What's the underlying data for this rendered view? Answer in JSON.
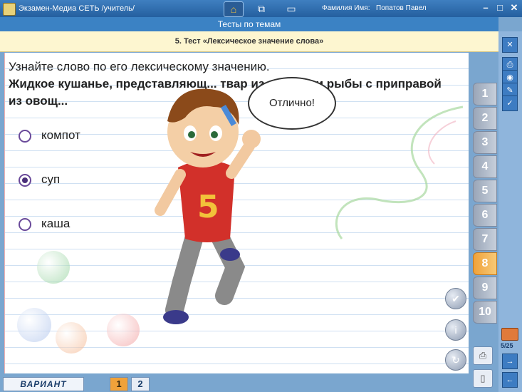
{
  "window": {
    "title": "Экзамен-Медиа СЕТЬ /учитель/",
    "user_label": "Фамилия Имя:",
    "user_name": "Попатов Павел",
    "controls": {
      "minimize": "–",
      "maximize": "□",
      "close": "✕"
    }
  },
  "nav": {
    "home_icon": "home-icon",
    "tree_icon": "sitemap-icon",
    "book_icon": "book-icon"
  },
  "header": {
    "title": "Тесты по темам"
  },
  "test": {
    "title": "5. Тест «Лексическое значение слова»"
  },
  "question": {
    "intro": "Узнайте слово по его лексическому значению.",
    "text": "Жидкое кушанье, представляющ... твар из мяса или рыбы с приправой из овощ..."
  },
  "options": [
    {
      "label": "компот",
      "selected": false
    },
    {
      "label": "суп",
      "selected": true
    },
    {
      "label": "каша",
      "selected": false
    }
  ],
  "feedback": {
    "text": "Отлично!"
  },
  "mascot": {
    "shirt_number": "5"
  },
  "tabs": [
    "1",
    "2",
    "3",
    "4",
    "5",
    "6",
    "7",
    "8",
    "9",
    "10"
  ],
  "active_tab": "8",
  "progress": {
    "text": "5/25"
  },
  "bottom": {
    "variant_label": "ВАРИАНТ",
    "variants": [
      "1",
      "2"
    ],
    "active_variant": "1"
  },
  "colors": {
    "accent": "#f0a23a",
    "header": "#3b82c4",
    "title_bar": "#fdf6d0"
  }
}
